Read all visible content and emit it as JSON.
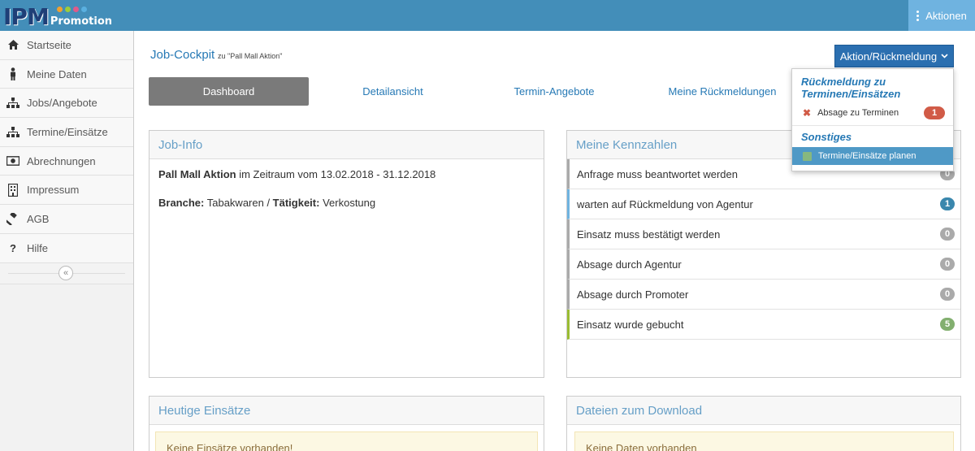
{
  "app": {
    "logo_main": "IPM",
    "logo_sub": "Promotion",
    "actions_label": "Aktionen"
  },
  "sidebar": {
    "items": [
      {
        "label": "Startseite",
        "icon": "home-icon"
      },
      {
        "label": "Meine Daten",
        "icon": "user-icon"
      },
      {
        "label": "Jobs/Angebote",
        "icon": "sitemap-icon"
      },
      {
        "label": "Termine/Einsätze",
        "icon": "sitemap-icon"
      },
      {
        "label": "Abrechnungen",
        "icon": "money-icon"
      },
      {
        "label": "Impressum",
        "icon": "building-icon"
      },
      {
        "label": "AGB",
        "icon": "gavel-icon"
      },
      {
        "label": "Hilfe",
        "icon": "question-icon"
      }
    ],
    "collapse_icon": "double-chevron-left-icon"
  },
  "header": {
    "title": "Job-Cockpit",
    "subtitle": "zu \"Pall Mall Aktion\"",
    "action_button": "Aktion/Rückmeldung"
  },
  "tabs": [
    {
      "label": "Dashboard",
      "active": true
    },
    {
      "label": "Detailansicht",
      "active": false
    },
    {
      "label": "Termin-Angebote",
      "active": false
    },
    {
      "label": "Meine Rückmeldungen",
      "active": false
    }
  ],
  "job_info": {
    "title": "Job-Info",
    "job_name": "Pall Mall Aktion",
    "period_text": " im Zeitraum vom 13.02.2018 - 31.12.2018",
    "branche_label": "Branche:",
    "branche_value": " Tabakwaren / ",
    "taetigkeit_label": "Tätigkeit:",
    "taetigkeit_value": " Verkostung"
  },
  "kennzahlen": {
    "title": "Meine Kennzahlen",
    "rows": [
      {
        "label": "Anfrage muss beantwortet werden",
        "count": "0",
        "color": "#aaaaaa",
        "border": "#aaaaaa"
      },
      {
        "label": "warten auf Rückmeldung von Agentur",
        "count": "1",
        "color": "#3a87ad",
        "border": "#6fb3e0"
      },
      {
        "label": "Einsatz muss bestätigt werden",
        "count": "0",
        "color": "#aaaaaa",
        "border": "#aaaaaa"
      },
      {
        "label": "Absage durch Agentur",
        "count": "0",
        "color": "#aaaaaa",
        "border": "#aaaaaa"
      },
      {
        "label": "Absage durch Promoter",
        "count": "0",
        "color": "#aaaaaa",
        "border": "#aaaaaa"
      },
      {
        "label": "Einsatz wurde gebucht",
        "count": "5",
        "color": "#82af6f",
        "border": "#9abc32"
      }
    ]
  },
  "heutige": {
    "title": "Heutige Einsätze",
    "empty": "Keine Einsätze vorhanden!"
  },
  "dateien": {
    "title": "Dateien zum Download",
    "empty": "Keine Daten vorhanden"
  },
  "dropdown": {
    "header1": "Rückmeldung zu Terminen/Einsätzen",
    "item1_label": "Absage zu Terminen",
    "item1_count": "1",
    "header2": "Sonstiges",
    "item2_label": "Termine/Einsätze planen"
  },
  "colors": {
    "topbar": "#438eb9",
    "accent": "#2679b5",
    "badge_red": "#d15b47"
  }
}
